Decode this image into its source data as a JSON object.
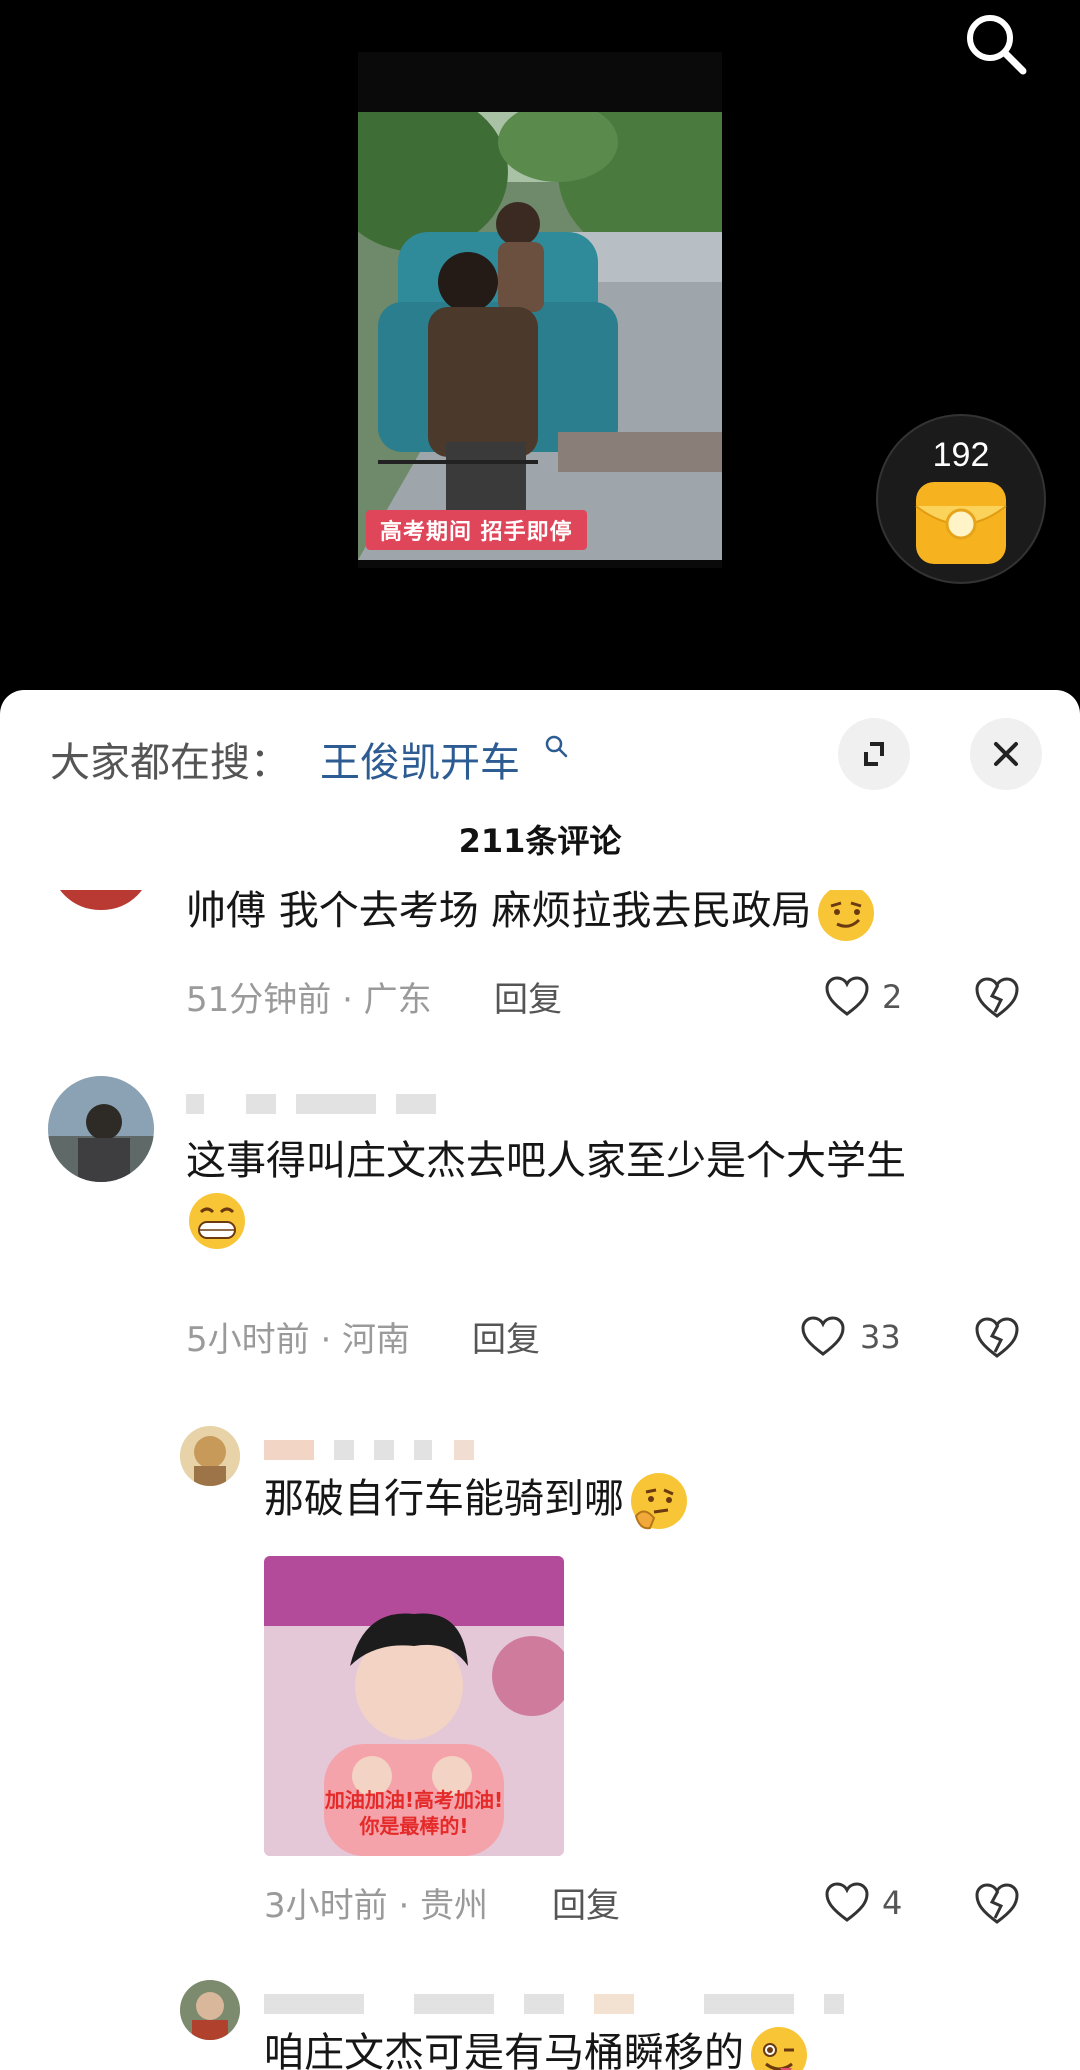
{
  "redpack": {
    "count": "192"
  },
  "video": {
    "caption": "高考期间 招手即停"
  },
  "header": {
    "hot_prefix": "大家都在搜：",
    "hot_term": "王俊凯开车",
    "comment_count": "211条评论"
  },
  "comments": [
    {
      "text": "帅傅 我个去考场 麻烦拉我去民政局",
      "time_loc": "51分钟前 · 广东",
      "reply": "回复",
      "likes": "2"
    },
    {
      "text": "这事得叫庄文杰去吧人家至少是个大学生",
      "time_loc": "5小时前 · 河南",
      "reply": "回复",
      "likes": "33"
    },
    {
      "text": "那破自行车能骑到哪",
      "sticker_text_1": "加油加油!高考加油!",
      "sticker_text_2": "你是最棒的!",
      "time_loc": "3小时前 · 贵州",
      "reply": "回复",
      "likes": "4"
    },
    {
      "text": "咱庄文杰可是有马桶瞬移的"
    }
  ],
  "colors": {
    "accent_link": "#2d5c93",
    "caption_bg": "#e0465a",
    "meta_gray": "#9a9a9a"
  }
}
